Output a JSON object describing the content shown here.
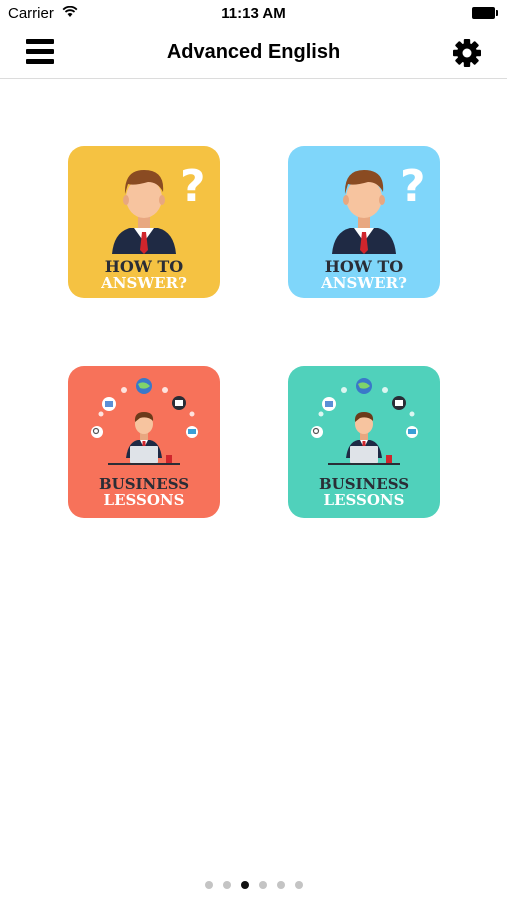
{
  "status_bar": {
    "carrier": "Carrier",
    "time": "11:13 AM"
  },
  "navbar": {
    "title": "Advanced English",
    "menu_icon": "hamburger-menu-icon",
    "settings_icon": "gear-icon"
  },
  "tiles": [
    {
      "line1": "HOW TO",
      "line2": "ANSWER?",
      "color": "#f5c242",
      "icon": "question-man-illustration"
    },
    {
      "line1": "HOW TO",
      "line2": "ANSWER?",
      "color": "#7fd6fa",
      "icon": "question-man-illustration"
    },
    {
      "line1": "BUSINESS",
      "line2": "LESSONS",
      "color": "#f7725a",
      "icon": "businessman-laptop-illustration"
    },
    {
      "line1": "BUSINESS",
      "line2": "LESSONS",
      "color": "#50d1bb",
      "icon": "businessman-laptop-illustration"
    }
  ],
  "page_indicator": {
    "count": 6,
    "active_index": 2
  }
}
